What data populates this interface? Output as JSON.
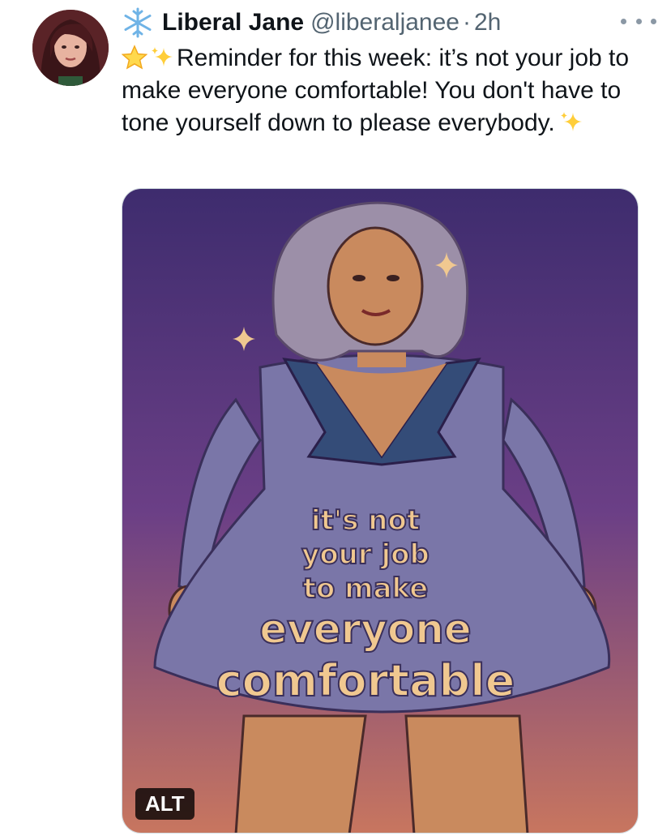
{
  "tweet": {
    "display_name": "Liberal Jane",
    "handle": "@liberaljanee",
    "separator": "·",
    "time": "2h",
    "badge_icon": "snowflake-icon",
    "text_line1": "Reminder for this week: it’s not your",
    "text_rest": "job to make everyone comfortable! You don't have to tone yourself down to please everybody.",
    "emojis": [
      "star-icon",
      "sparkles-icon"
    ],
    "more_icon": "more-options-icon"
  },
  "media": {
    "alt_label": "ALT",
    "dress_lines": [
      "it's not",
      "your job",
      "to make",
      "everyone",
      "comfortable"
    ],
    "colors": {
      "bg_top": "#3e2c6e",
      "bg_mid": "#6b3f86",
      "bg_bottom": "#c8765f",
      "dress": "#7a76a8",
      "collar": "#344c78",
      "skin": "#c98a5e",
      "hair": "#9c8fa8",
      "lettering": "#f0c890"
    }
  }
}
